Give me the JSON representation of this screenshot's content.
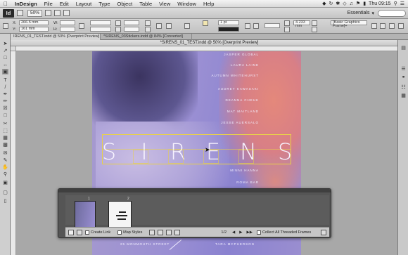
{
  "menubar": {
    "app_name": "InDesign",
    "items": [
      "File",
      "Edit",
      "Layout",
      "Type",
      "Object",
      "Table",
      "View",
      "Window",
      "Help"
    ],
    "clock": "Thu 09:15"
  },
  "appbar": {
    "logo": "Id",
    "zoom": "50%",
    "workspace": "Essentials"
  },
  "control": {
    "x_label": "X:",
    "x_value": "266.5 mm",
    "y_label": "Y:",
    "y_value": "161 mm",
    "w_label": "W:",
    "h_label": "H:",
    "stroke_weight": "1 pt",
    "width_value": "4.233 mm",
    "style_field": "[Basic Graphics Frame]+"
  },
  "tabs": [
    {
      "label": "IRENS_01_TEST.indd @ 50% [Overprint Preview]"
    },
    {
      "label": "*SIRENS_03Stickers.indd @ 84% [Converted]"
    }
  ],
  "document_title": "*SIRENS_01_TEST.indd @ 50% [Overprint Preview]",
  "poster": {
    "title_letters": [
      "S",
      "I",
      "R",
      "E",
      "N",
      "S"
    ],
    "credits": [
      "JASPER GLOBAL",
      "LAURA LAINE",
      "AUTUMN WHITEHURST",
      "AUDREY KAWASAKI",
      "DEANNA CHEUK",
      "MAT MAITLAND",
      "JESSE AUERSALO"
    ],
    "credits_lower": [
      "MINNI HANNA",
      "ROMA BAR"
    ],
    "address": "25 MONMOUTH STREET",
    "bottom_credit": "TARA MCPHERSON"
  },
  "panel": {
    "page_num_1": "1",
    "page_num_2": "2",
    "create_link": "Create Link",
    "map_styles": "Map Styles",
    "page_counter": "1/2",
    "collect_threads": "Collect All Threaded Frames"
  }
}
